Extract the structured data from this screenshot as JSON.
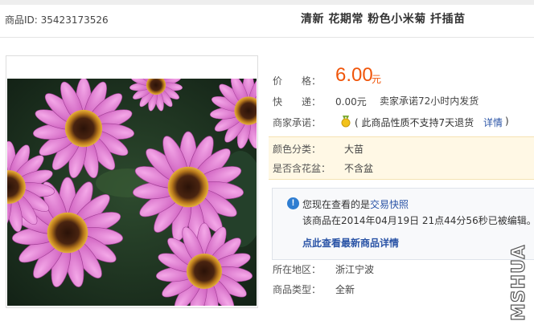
{
  "header": {
    "product_id_label": "商品ID:",
    "product_id": "35423173526",
    "title": "清新 花期常 粉色小米菊 扦插苗"
  },
  "price": {
    "label": "价　　格：",
    "value": "6.00",
    "unit": "元",
    "color": "#f0550a"
  },
  "shipping": {
    "label": "快　　递：",
    "value": "0.00元",
    "note": "卖家承诺72小时内发货"
  },
  "promise": {
    "label": "商家承诺：",
    "icon": "medal-icon",
    "text": "( 此商品性质不支持7天退货",
    "link": "详情",
    "close": ")"
  },
  "attributes": [
    {
      "label": "颜色分类：",
      "value": "大苗"
    },
    {
      "label": "是否含花盆：",
      "value": "不含盆"
    }
  ],
  "snapshot": {
    "prefix": "您现在查看的是",
    "link": "交易快照",
    "notice": "该商品在2014年04月19日 21点44分56秒已被编辑。",
    "detail_link": "点此查看最新商品详情"
  },
  "location": {
    "label": "所在地区：",
    "value": "浙江宁波"
  },
  "type": {
    "label": "商品类型：",
    "value": "全新"
  },
  "watermark": "MSHUA",
  "colors": {
    "accent": "#f0550a",
    "link": "#2953a6",
    "attr_bg": "#fff8e5"
  }
}
